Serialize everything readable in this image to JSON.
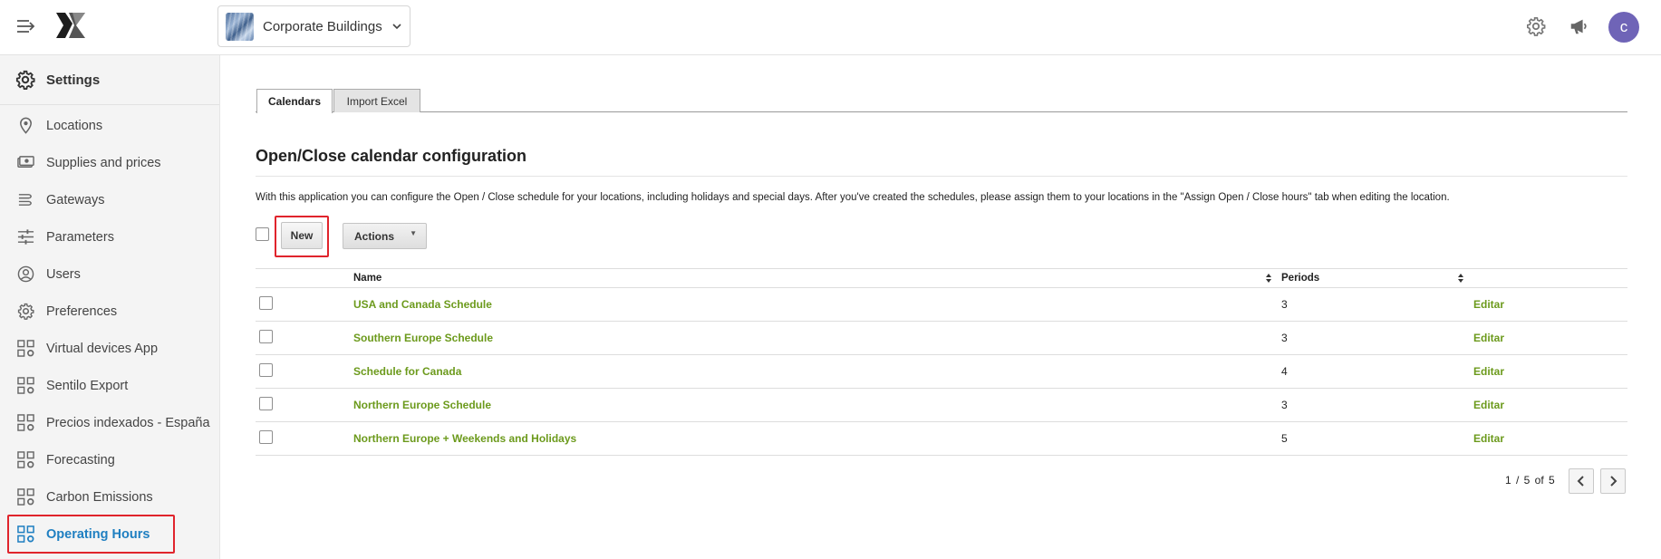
{
  "header": {
    "menu_icon": "menu-collapse-icon",
    "logo_icon": "brand-logo-icon",
    "org_selector": {
      "label": "Corporate Buildings",
      "chevron_icon": "chevron-down-icon"
    },
    "icons": [
      "gear-icon",
      "megaphone-icon"
    ],
    "avatar": {
      "initial": "c",
      "color": "#6f64b7"
    }
  },
  "sidebar": {
    "title": "Settings",
    "title_icon": "gear-icon",
    "items": [
      {
        "label": "Locations",
        "icon": "location-pin-icon"
      },
      {
        "label": "Supplies and prices",
        "icon": "money-icon"
      },
      {
        "label": "Gateways",
        "icon": "gateway-icon"
      },
      {
        "label": "Parameters",
        "icon": "sliders-icon"
      },
      {
        "label": "Users",
        "icon": "user-circle-icon"
      },
      {
        "label": "Preferences",
        "icon": "gear-icon"
      },
      {
        "label": "Virtual devices App",
        "icon": "app-grid-gear-icon"
      },
      {
        "label": "Sentilo Export",
        "icon": "app-grid-gear-icon"
      },
      {
        "label": "Precios indexados - España",
        "icon": "app-grid-gear-icon"
      },
      {
        "label": "Forecasting",
        "icon": "app-grid-gear-icon"
      },
      {
        "label": "Carbon Emissions",
        "icon": "app-grid-gear-icon"
      },
      {
        "label": "Operating Hours",
        "icon": "app-grid-gear-icon",
        "active": true
      }
    ]
  },
  "main": {
    "tabs": [
      {
        "label": "Calendars",
        "active": true
      },
      {
        "label": "Import Excel",
        "active": false
      }
    ],
    "title": "Open/Close calendar configuration",
    "description": "With this application you can configure the Open / Close schedule for your locations, including holidays and special days. After you've created the schedules, please assign them to your locations in the \"Assign Open / Close hours\" tab when editing the location.",
    "toolbar": {
      "new_label": "New",
      "actions_label": "Actions",
      "actions_caret": "▼"
    },
    "table": {
      "columns": {
        "name": "Name",
        "periods": "Periods"
      },
      "rows": [
        {
          "name": "USA and Canada Schedule",
          "periods": "3",
          "edit": "Editar"
        },
        {
          "name": "Southern Europe Schedule",
          "periods": "3",
          "edit": "Editar"
        },
        {
          "name": "Schedule for Canada",
          "periods": "4",
          "edit": "Editar"
        },
        {
          "name": "Northern Europe Schedule",
          "periods": "3",
          "edit": "Editar"
        },
        {
          "name": "Northern Europe + Weekends and Holidays",
          "periods": "5",
          "edit": "Editar"
        }
      ]
    },
    "pagination": {
      "info": "1 / 5 of 5"
    }
  },
  "colors": {
    "accent_link": "#6c9a1c",
    "active_nav": "#1f7fc1",
    "highlight": "#e0242c"
  }
}
